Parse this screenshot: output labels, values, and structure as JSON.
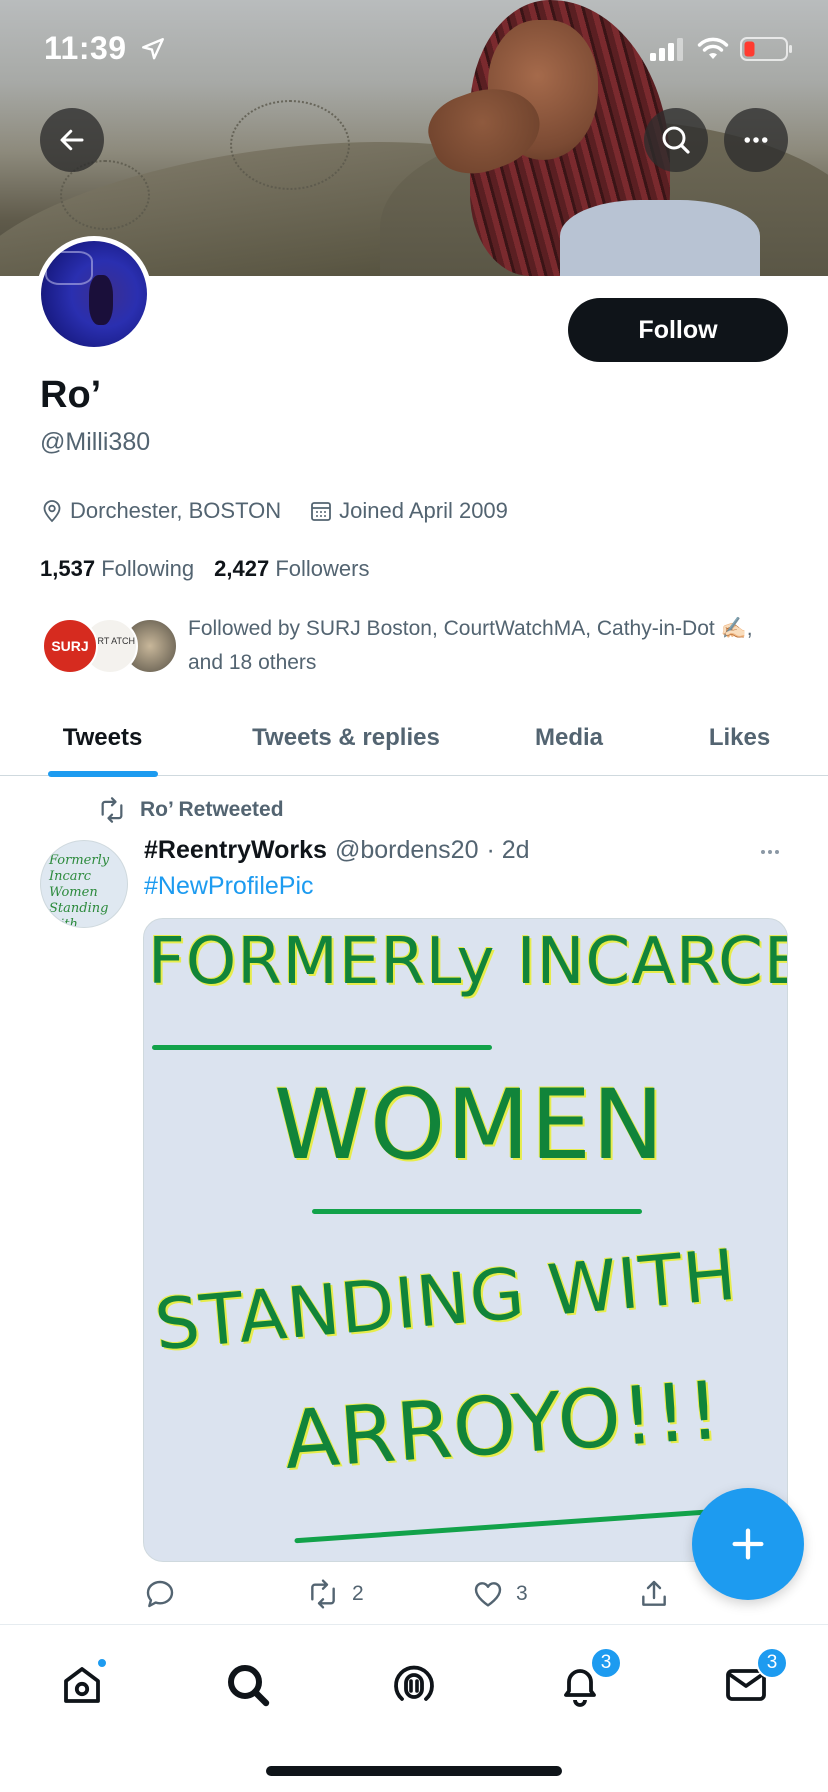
{
  "status_bar": {
    "time": "11:39"
  },
  "profile": {
    "follow_label": "Follow",
    "name": "Ro’",
    "handle": "@Milli380",
    "location": "Dorchester, BOSTON",
    "joined": "Joined April 2009",
    "following_count": "1,537",
    "following_label": "Following",
    "followers_count": "2,427",
    "followers_label": "Followers",
    "followed_by": "Followed by SURJ Boston, CourtWatchMA, Cathy-in-Dot ✍🏻, and 18 others",
    "follower_avatar_1": "SURJ",
    "follower_avatar_2": "OURT ATCH A"
  },
  "tabs": [
    {
      "label": "Tweets",
      "active": true
    },
    {
      "label": "Tweets & replies",
      "active": false
    },
    {
      "label": "Media",
      "active": false
    },
    {
      "label": "Likes",
      "active": false
    }
  ],
  "tweet": {
    "retweet_label": "Ro’ Retweeted",
    "display_name": "#ReentryWorks",
    "username": "@bordens20",
    "time": "· 2d",
    "text": "#NewProfilePic",
    "avatar_text": "Formerly Incarc Women Standing with Arroyo!!!",
    "media_lines": [
      "FORMERLy INCARCER",
      "WOMEN",
      "STANDING WITH",
      "ARROYO!!!"
    ],
    "retweets": "2",
    "likes": "3"
  },
  "bottom_nav": {
    "notifications_badge": "3",
    "messages_badge": "3"
  },
  "colors": {
    "accent": "#1d9bf0",
    "text_primary": "#0f1419",
    "text_secondary": "#536471"
  },
  "icons": [
    "back-arrow-icon",
    "search-icon",
    "more-icon",
    "location-icon",
    "calendar-icon",
    "retweet-icon",
    "reply-icon",
    "like-icon",
    "share-icon",
    "compose-plus-icon",
    "home-icon",
    "explore-icon",
    "spaces-icon",
    "bell-icon",
    "mail-icon"
  ]
}
